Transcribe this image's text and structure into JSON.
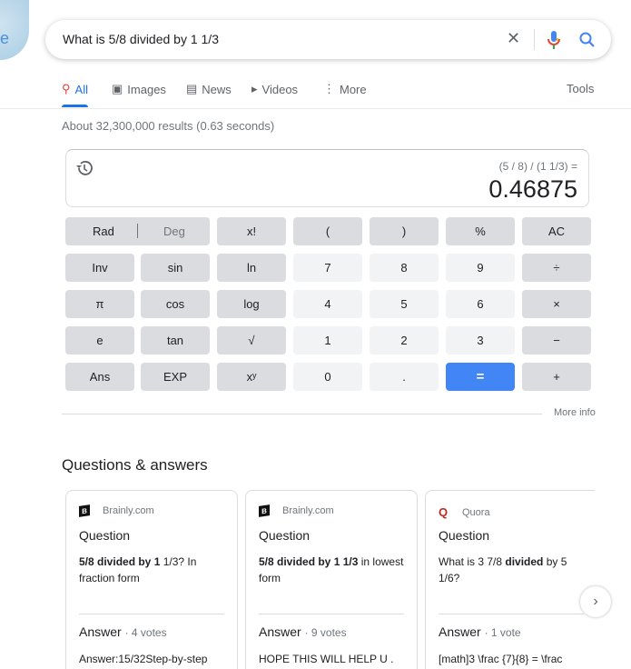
{
  "search": {
    "query": "What is 5/8 divided by 1 1/3"
  },
  "tabs": [
    {
      "label": "All",
      "icon": "search-icon"
    },
    {
      "label": "Images",
      "icon": "image-icon"
    },
    {
      "label": "News",
      "icon": "news-icon"
    },
    {
      "label": "Videos",
      "icon": "play-icon"
    },
    {
      "label": "More",
      "icon": "dots-vertical-icon"
    }
  ],
  "tools_label": "Tools",
  "stats": "About 32,300,000 results (0.63 seconds)",
  "calculator": {
    "expression": "(5 / 8) / (1 1/3) =",
    "result": "0.46875",
    "rad": "Rad",
    "deg": "Deg",
    "keys": [
      [
        "x!",
        "(",
        ")",
        "%",
        "AC"
      ],
      [
        "Inv",
        "sin",
        "ln",
        "7",
        "8",
        "9",
        "÷"
      ],
      [
        "π",
        "cos",
        "log",
        "4",
        "5",
        "6",
        "×"
      ],
      [
        "e",
        "tan",
        "√",
        "1",
        "2",
        "3",
        "−"
      ],
      [
        "Ans",
        "EXP",
        "xʸ",
        "0",
        ".",
        "=",
        "+"
      ]
    ]
  },
  "more_info": "More info",
  "qa": {
    "title": "Questions & answers",
    "cards": [
      {
        "source": "Brainly.com",
        "logo": "B",
        "heading": "Question",
        "q": [
          {
            "t": "5/8 divided by 1",
            "b": true
          },
          {
            "t": " 1/3? In fraction form",
            "b": false
          }
        ],
        "answer": "Answer",
        "votes": "· 4 votes",
        "a": "Answer:15/32Step-by-step"
      },
      {
        "source": "Brainly.com",
        "logo": "B",
        "heading": "Question",
        "q": [
          {
            "t": "5/8 divided by 1 1/3",
            "b": true
          },
          {
            "t": " in lowest form",
            "b": false
          }
        ],
        "answer": "Answer",
        "votes": "· 9 votes",
        "a": "HOPE THIS WILL HELP U ."
      },
      {
        "source": "Quora",
        "logo": "Q",
        "heading": "Question",
        "q": [
          {
            "t": "What is 3 7/8 ",
            "b": false
          },
          {
            "t": "divided",
            "b": true
          },
          {
            "t": " by 5 1/6?",
            "b": false
          }
        ],
        "answer": "Answer",
        "votes": "· 1 vote",
        "a": "[math]3 \\frac {7}{8} = \\frac"
      }
    ]
  },
  "colors": {
    "accent": "#1a73e8",
    "equals": "#4285f4",
    "op_key": "#dadce0",
    "num_key": "#f1f3f4"
  }
}
